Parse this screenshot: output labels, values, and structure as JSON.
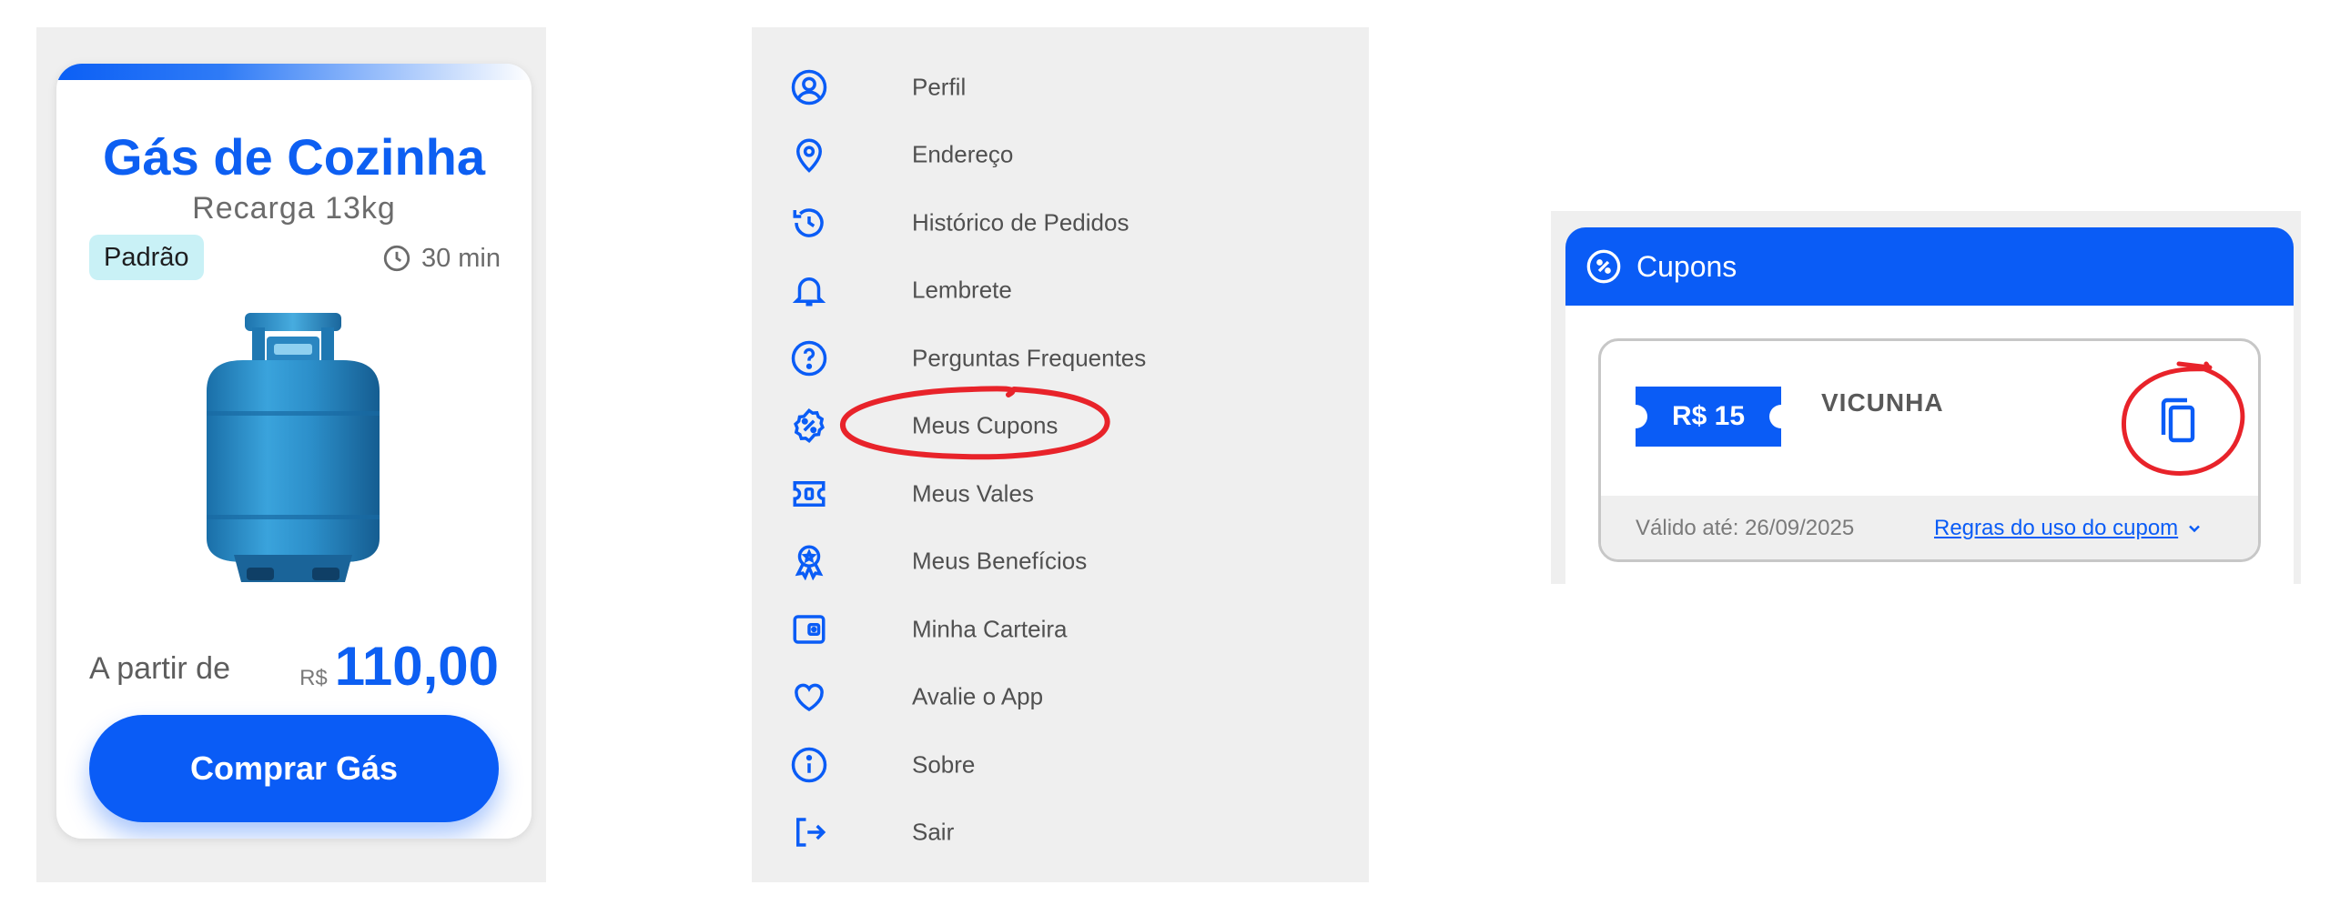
{
  "product_card": {
    "title": "Gás de Cozinha",
    "subtitle": "Recarga 13kg",
    "badge": "Padrão",
    "eta": "30 min",
    "eta_icon": "clock-icon",
    "image": "gas-cylinder-icon",
    "price_prefix": "A partir de",
    "currency": "R$",
    "price": "110,00",
    "buy_button": "Comprar Gás"
  },
  "menu": {
    "items": [
      {
        "label": "Perfil",
        "icon": "user-circle-icon"
      },
      {
        "label": "Endereço",
        "icon": "map-pin-icon"
      },
      {
        "label": "Histórico de Pedidos",
        "icon": "history-icon"
      },
      {
        "label": "Lembrete",
        "icon": "bell-icon"
      },
      {
        "label": "Perguntas Frequentes",
        "icon": "help-circle-icon"
      },
      {
        "label": "Meus Cupons",
        "icon": "percent-badge-icon"
      },
      {
        "label": "Meus Vales",
        "icon": "voucher-icon"
      },
      {
        "label": "Meus Benefícios",
        "icon": "award-icon"
      },
      {
        "label": "Minha Carteira",
        "icon": "wallet-icon"
      },
      {
        "label": "Avalie o App",
        "icon": "heart-icon"
      },
      {
        "label": "Sobre",
        "icon": "info-icon"
      },
      {
        "label": "Sair",
        "icon": "logout-icon"
      }
    ],
    "highlighted": "Meus Cupons"
  },
  "coupons": {
    "header": "Cupons",
    "coupon": {
      "amount": "R$ 15",
      "code": "VICUNHA",
      "valid_until": "Válido até: 26/09/2025",
      "rules_link": "Regras do uso do cupom"
    }
  },
  "colors": {
    "brand_blue": "#0A5CF6",
    "annotation_red": "#E8232A",
    "badge_bg": "#C9F1F6",
    "panel_bg": "#EFEFEF"
  }
}
